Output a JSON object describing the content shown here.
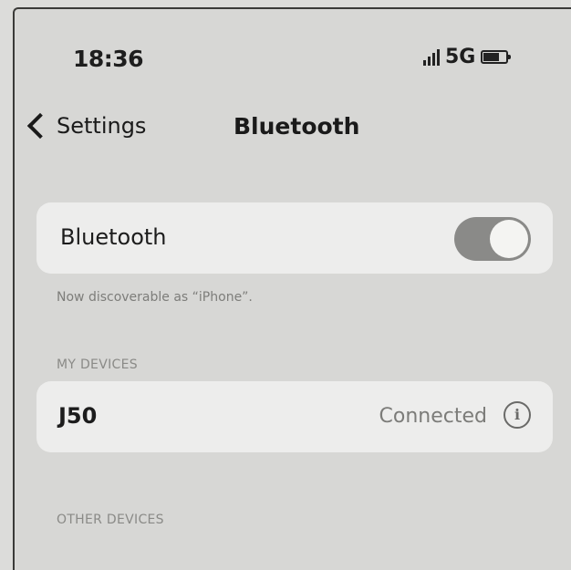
{
  "status_bar": {
    "time": "18:36",
    "network": "5G",
    "icons": [
      "signal-icon",
      "battery-icon"
    ]
  },
  "nav": {
    "back_label": "Settings",
    "title": "Bluetooth",
    "back_icon": "chevron-left-icon"
  },
  "bluetooth": {
    "label": "Bluetooth",
    "enabled": true,
    "discoverable_note": "Now discoverable as “iPhone”."
  },
  "my_devices": {
    "header": "MY DEVICES",
    "items": [
      {
        "name": "J50",
        "status": "Connected",
        "icon": "info-icon"
      }
    ]
  },
  "other_devices": {
    "header": "OTHER DEVICES"
  },
  "colors": {
    "background": "#d7d7d5",
    "card": "#ededec",
    "toggle_on": "#8a8a88"
  }
}
